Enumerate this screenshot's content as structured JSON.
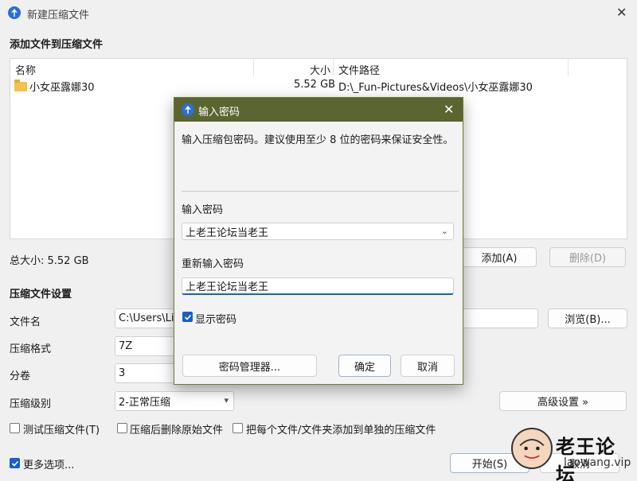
{
  "window": {
    "title": "新建压缩文件",
    "close_glyph": "✕"
  },
  "add_section": {
    "heading": "添加文件到压缩文件",
    "columns": {
      "name": "名称",
      "size": "大小",
      "path": "文件路径"
    },
    "rows": [
      {
        "name": "小女巫露娜30",
        "size": "5.52 GB",
        "path": "D:\\_Fun-Pictures&Videos\\小女巫露娜30",
        "icon": "folder-icon"
      }
    ],
    "total_size": "总大小: 5.52 GB",
    "add_button": "添加(A)",
    "delete_button": "删除(D)"
  },
  "settings": {
    "heading": "压缩文件设置",
    "filename_label": "文件名",
    "filename_value": "C:\\Users\\Liu",
    "browse_button": "浏览(B)...",
    "format_label": "压缩格式",
    "format_value": "7Z",
    "split_label": "分卷",
    "split_value": "3",
    "level_label": "压缩级别",
    "level_value": "2-正常压缩",
    "advanced_button": "高级设置 »",
    "test_checkbox": "测试压缩文件(T)",
    "delete_after_checkbox": "压缩后删除原始文件",
    "separate_checkbox": "把每个文件/文件夹添加到单独的压缩文件",
    "more_options": "更多选项...",
    "start_button": "开始(S)",
    "cancel_button": "取消"
  },
  "dialog": {
    "title": "输入密码",
    "description": "输入压缩包密码。建议使用至少 8 位的密码来保证安全性。",
    "password_label": "输入密码",
    "password_value": "上老王论坛当老王",
    "confirm_label": "重新输入密码",
    "confirm_value": "上老王论坛当老王",
    "show_password": "显示密码",
    "show_password_checked": true,
    "manager_button": "密码管理器...",
    "ok_button": "确定",
    "cancel_button": "取消",
    "titlebar_color": "#5a6530"
  },
  "watermark": {
    "text": "老王论坛",
    "url": "laowang.vip"
  }
}
